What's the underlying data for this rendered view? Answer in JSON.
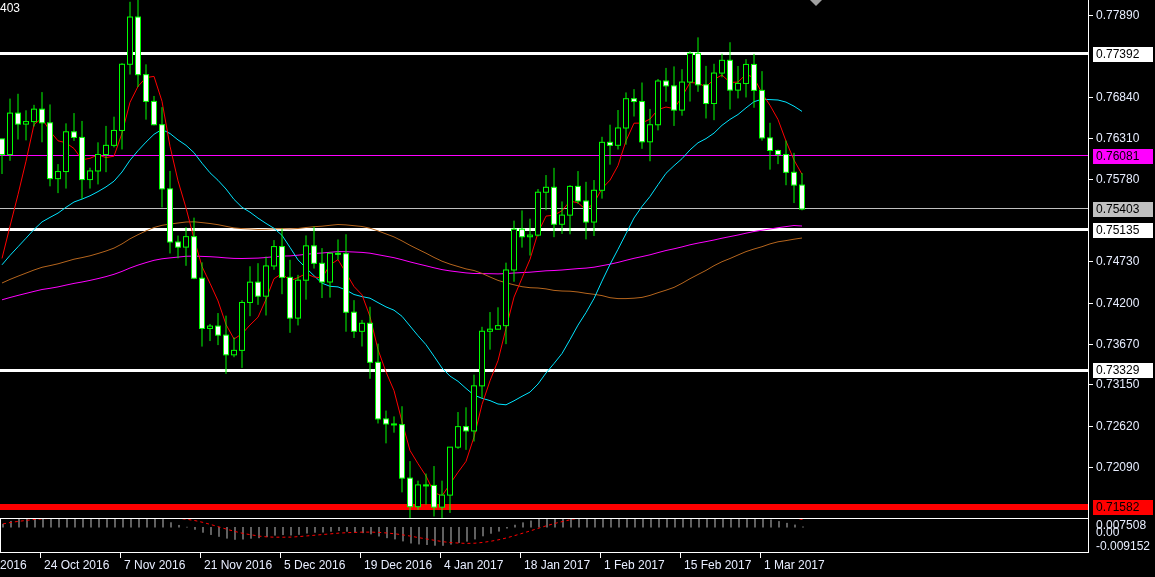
{
  "symbol_fragment": "403",
  "price_axis": [
    "0.77890",
    "0.76840",
    "0.76310",
    "0.75780",
    "0.74730",
    "0.74200",
    "0.73670",
    "0.73150",
    "0.72620",
    "0.72090"
  ],
  "price_levels": [
    {
      "label": "0.77392",
      "color": "#ffffff",
      "kind": "thick"
    },
    {
      "label": "0.76081",
      "color": "#ff00ff",
      "kind": "thin"
    },
    {
      "label": "0.75403",
      "color": "#c0c0c0",
      "kind": "thin"
    },
    {
      "label": "0.75135",
      "color": "#ffffff",
      "kind": "thick"
    },
    {
      "label": "0.73329",
      "color": "#ffffff",
      "kind": "thick"
    },
    {
      "label": "0.71582",
      "color": "#ff0000",
      "kind": "heavy"
    }
  ],
  "indicator_axis": [
    "0.007508",
    "0.00",
    "-0.009152"
  ],
  "date_axis": [
    "2016",
    "24 Oct 2016",
    "7 Nov 2016",
    "21 Nov 2016",
    "5 Dec 2016",
    "19 Dec 2016",
    "4 Jan 2017",
    "18 Jan 2017",
    "1 Feb 2017",
    "15 Feb 2017",
    "1 Mar 2017"
  ]
}
